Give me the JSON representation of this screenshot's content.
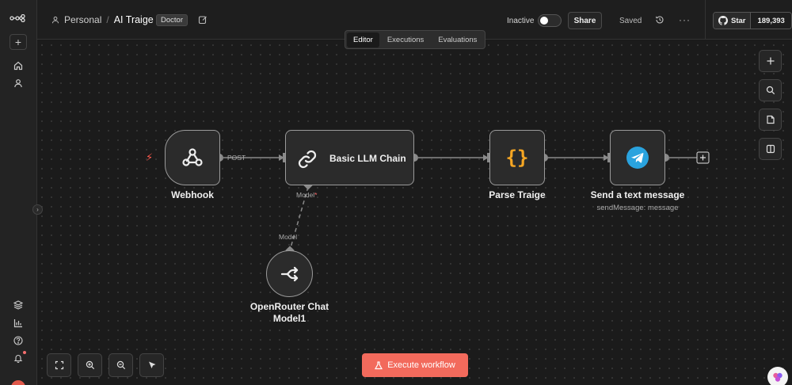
{
  "header": {
    "project": "Personal",
    "separator": "/",
    "workflow_name": "AI Traige",
    "tag": "Doctor",
    "status_label": "Inactive",
    "share_label": "Share",
    "saved_label": "Saved",
    "github": {
      "star_label": "Star",
      "star_count": "189,393"
    }
  },
  "tabs": [
    {
      "label": "Editor",
      "active": true
    },
    {
      "label": "Executions",
      "active": false
    },
    {
      "label": "Evaluations",
      "active": false
    }
  ],
  "nodes": {
    "webhook": {
      "title": "Webhook",
      "output_label": "POST",
      "icon": "webhook-icon"
    },
    "llm_chain": {
      "title": "Basic LLM Chain",
      "model_port_label": "Model",
      "required_marker": "*",
      "icon": "link-icon"
    },
    "parse": {
      "title": "Parse Traige",
      "icon": "code-braces-icon"
    },
    "telegram": {
      "title": "Send a text message",
      "subtitle": "sendMessage: message",
      "icon": "telegram-icon"
    },
    "openrouter": {
      "title_line1": "OpenRouter Chat",
      "title_line2": "Model1",
      "port_label": "Model",
      "icon": "openrouter-icon"
    }
  },
  "toolbar": {
    "execute_label": "Execute workflow"
  },
  "colors": {
    "accent": "#f26a5c",
    "trigger": "#ff5a4e",
    "telegram": "#2aa3de",
    "code_brace": "#f5a623",
    "canvas_bg": "#1b1b1b"
  }
}
